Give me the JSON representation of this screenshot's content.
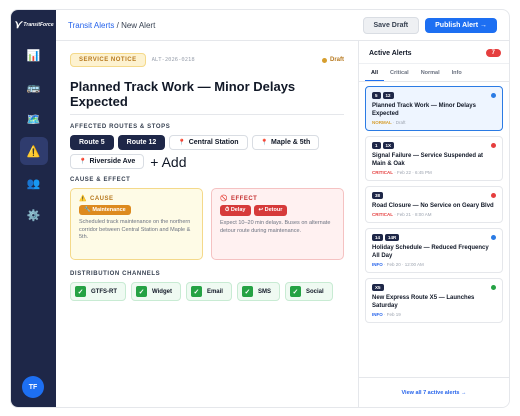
{
  "app": {
    "logo_mark": "⋎",
    "logo_text": "TransitForce"
  },
  "sidebar": {
    "items": [
      {
        "name": "dashboard",
        "icon": "📊"
      },
      {
        "name": "fleet",
        "icon": "🚌"
      },
      {
        "name": "map",
        "icon": "🗺️"
      },
      {
        "name": "alerts",
        "icon": "⚠️"
      },
      {
        "name": "users",
        "icon": "👥"
      },
      {
        "name": "settings",
        "icon": "⚙️"
      }
    ],
    "avatar_initials": "TF"
  },
  "header": {
    "breadcrumb_parent": "Transit Alerts",
    "breadcrumb_sep": " / ",
    "breadcrumb_current": "New Alert",
    "save_draft": "Save Draft",
    "publish": "Publish Alert →"
  },
  "editor": {
    "notice_type": "SERVICE NOTICE",
    "alert_id": "ALT-2026-0218",
    "status": "Draft",
    "title": "Planned Track Work — Minor Delays Expected",
    "routes_heading": "AFFECTED ROUTES & STOPS",
    "routes": [
      "Route 5",
      "Route 12"
    ],
    "stops": [
      "Central Station",
      "Maple & 5th",
      "Riverside Ave"
    ],
    "add_label": "+ Add",
    "cause_effect_heading": "CAUSE & EFFECT",
    "cause": {
      "label": "CAUSE",
      "tag": "🔧 Maintenance",
      "description": "Scheduled track maintenance on the northern corridor between Central Station and Maple & 5th."
    },
    "effect": {
      "label": "EFFECT",
      "tags": [
        "⏱ Delay",
        "↩ Detour"
      ],
      "description": "Expect 10–20 min delays. Buses on alternate detour route during maintenance."
    },
    "channels_heading": "DISTRIBUTION CHANNELS",
    "channels": [
      "GTFS-RT",
      "Widget",
      "Email",
      "SMS",
      "Social"
    ]
  },
  "panel": {
    "title": "Active Alerts",
    "count": "7",
    "filters": [
      "All",
      "Critical",
      "Normal",
      "Info"
    ],
    "alerts": [
      {
        "badges": [
          "5",
          "12"
        ],
        "title": "Planned Track Work — Minor Delays Expected",
        "level": "NORMAL",
        "meta": "· Draft",
        "dot": "#2b7be4",
        "level_color": "#d69e2e"
      },
      {
        "badges": [
          "1",
          "1X"
        ],
        "title": "Signal Failure — Service Suspended at Main & Oak",
        "level": "CRITICAL",
        "meta": "· Feb 22 · 6:45 PM",
        "dot": "#e53e3e",
        "level_color": "#e53e3e"
      },
      {
        "badges": [
          "38"
        ],
        "title": "Road Closure — No Service on Geary Blvd",
        "level": "CRITICAL",
        "meta": "· Feb 21 · 8:00 AM",
        "dot": "#e53e3e",
        "level_color": "#e53e3e"
      },
      {
        "badges": [
          "14",
          "14R"
        ],
        "title": "Holiday Schedule — Reduced Frequency All Day",
        "level": "INFO",
        "meta": "· Feb 20 · 12:00 AM",
        "dot": "#2b7be4",
        "level_color": "#2563eb"
      },
      {
        "badges": [
          "X5"
        ],
        "title": "New Express Route X5 — Launches Saturday",
        "level": "INFO",
        "meta": "· Feb 19",
        "dot": "#25a244",
        "level_color": "#2563eb"
      }
    ],
    "footer": "View all 7 active alerts →"
  }
}
